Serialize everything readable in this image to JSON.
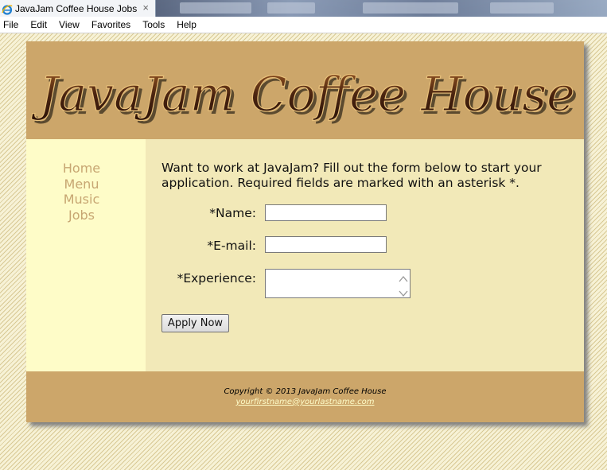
{
  "browser": {
    "tab_title": "JavaJam Coffee House Jobs",
    "tab_close": "×",
    "menu": [
      "File",
      "Edit",
      "View",
      "Favorites",
      "Tools",
      "Help"
    ]
  },
  "site": {
    "logo_text": "JavaJam Coffee House",
    "nav": [
      "Home",
      "Menu",
      "Music",
      "Jobs"
    ],
    "intro": "Want to work at JavaJam? Fill out the form below to start your application. Required fields are marked with an asterisk *.",
    "form": {
      "name_label": "*Name:",
      "name_value": "",
      "email_label": "*E-mail:",
      "email_value": "",
      "experience_label": "*Experience:",
      "experience_value": "",
      "submit_label": "Apply Now"
    },
    "footer": {
      "copyright": "Copyright © 2013 JavaJam Coffee House",
      "email": "yourfirstname@yourlastname.com"
    }
  },
  "colors": {
    "header": "#cca66a",
    "nav_bg": "#fefcc8",
    "content_bg": "#f2e9b8",
    "nav_link": "#c7a672"
  }
}
